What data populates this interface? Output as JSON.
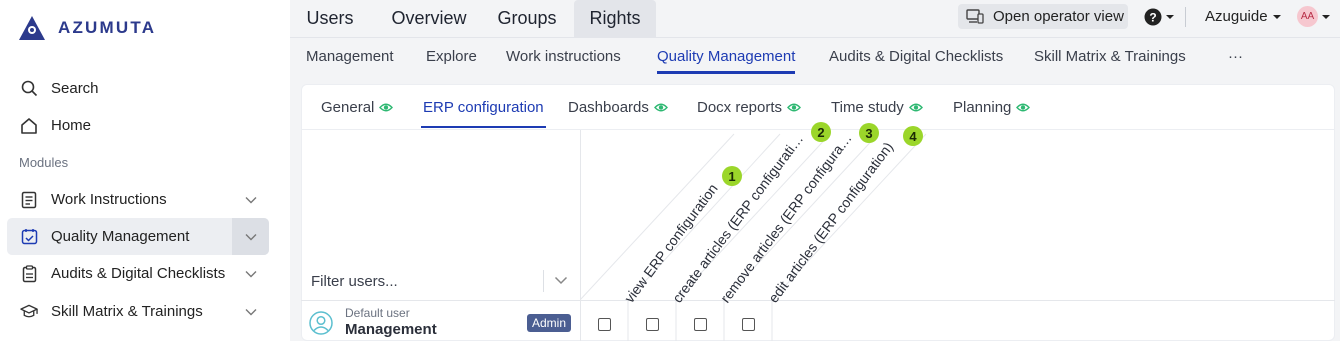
{
  "brand": {
    "name": "AZUMUTA"
  },
  "sidebar": {
    "search_label": "Search",
    "home_label": "Home",
    "modules_heading": "Modules",
    "items": [
      {
        "label": "Work Instructions",
        "icon": "document-icon"
      },
      {
        "label": "Quality Management",
        "icon": "calendar-check-icon",
        "active": true
      },
      {
        "label": "Audits & Digital Checklists",
        "icon": "clipboard-icon"
      },
      {
        "label": "Skill Matrix & Trainings",
        "icon": "graduation-cap-icon"
      }
    ]
  },
  "header": {
    "tabs": [
      {
        "label": "Users"
      },
      {
        "label": "Overview"
      },
      {
        "label": "Groups"
      },
      {
        "label": "Rights",
        "active": true
      }
    ],
    "operator_button": "Open operator view",
    "organization": "Azuguide",
    "avatar_initials": "AA"
  },
  "subnav": {
    "items": [
      {
        "label": "Management"
      },
      {
        "label": "Explore"
      },
      {
        "label": "Work instructions"
      },
      {
        "label": "Quality Management",
        "active": true
      },
      {
        "label": "Audits & Digital Checklists"
      },
      {
        "label": "Skill Matrix & Trainings"
      },
      {
        "label": "···"
      }
    ]
  },
  "inner_tabs": [
    {
      "label": "General",
      "eye": true
    },
    {
      "label": "ERP configuration",
      "active": true
    },
    {
      "label": "Dashboards",
      "eye": true
    },
    {
      "label": "Docx reports",
      "eye": true
    },
    {
      "label": "Time study",
      "eye": true
    },
    {
      "label": "Planning",
      "eye": true
    }
  ],
  "filter": {
    "placeholder": "Filter users..."
  },
  "permissions": [
    {
      "label": "view ERP configuration",
      "number": "1"
    },
    {
      "label": "create articles (ERP configurati…",
      "number": "2"
    },
    {
      "label": "remove articles (ERP configura…",
      "number": "3"
    },
    {
      "label": "edit articles (ERP configuration)",
      "number": "4"
    }
  ],
  "user": {
    "subtitle": "Default user",
    "name": "Management",
    "badge": "Admin",
    "checked": [
      false,
      false,
      false,
      false
    ]
  },
  "colors": {
    "accent": "#1d3bb3",
    "brand": "#2c3a8c",
    "eye": "#2eb872",
    "badge_green": "#9bd62a",
    "admin_badge": "#4b5e92"
  }
}
